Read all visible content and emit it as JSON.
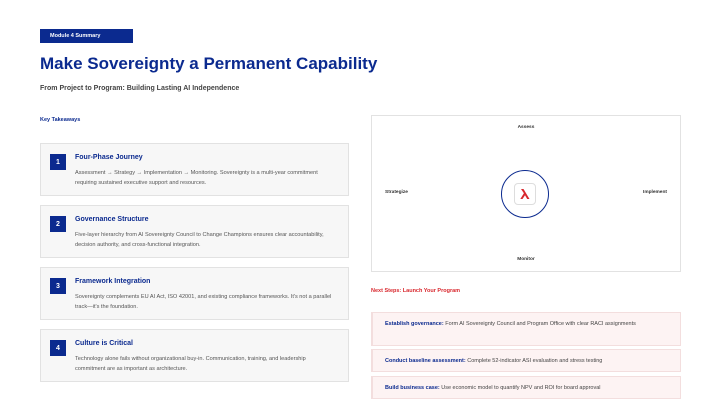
{
  "header": {
    "badge": "Module 4 Summary",
    "title": "Make Sovereignty a Permanent Capability",
    "subtitle": "From Project to Program: Building Lasting AI Independence"
  },
  "takeaways": {
    "label": "Key Takeaways",
    "items": [
      {
        "num": "1",
        "title": "Four-Phase Journey",
        "desc": "Assessment → Strategy → Implementation → Monitoring. Sovereignty is a multi-year commitment requiring sustained executive support and resources."
      },
      {
        "num": "2",
        "title": "Governance Structure",
        "desc": "Five-layer hierarchy from AI Sovereignty Council to Change Champions ensures clear accountability, decision authority, and cross-functional integration."
      },
      {
        "num": "3",
        "title": "Framework Integration",
        "desc": "Sovereignty complements EU AI Act, ISO 42001, and existing compliance frameworks. It's not a parallel track—it's the foundation."
      },
      {
        "num": "4",
        "title": "Culture is Critical",
        "desc": "Technology alone fails without organizational buy-in. Communication, training, and leadership commitment are as important as architecture."
      }
    ]
  },
  "cycle": {
    "top": "Assess",
    "right": "Implement",
    "bottom": "Monitor",
    "left": "Strategize",
    "center_icon": "lambda-logo-icon",
    "accent": "#0b2a8f",
    "logo_color": "#d8272d"
  },
  "next_steps": {
    "label": "Next Steps: Launch Your Program",
    "items": [
      {
        "bold": "Establish governance:",
        "text": " Form AI Sovereignty Council and Program Office with clear RACI assignments"
      },
      {
        "bold": "Conduct baseline assessment:",
        "text": " Complete 52-indicator ASI evaluation and stress testing"
      },
      {
        "bold": "Build business case:",
        "text": " Use economic model to quantify NPV and ROI for board approval"
      }
    ]
  }
}
